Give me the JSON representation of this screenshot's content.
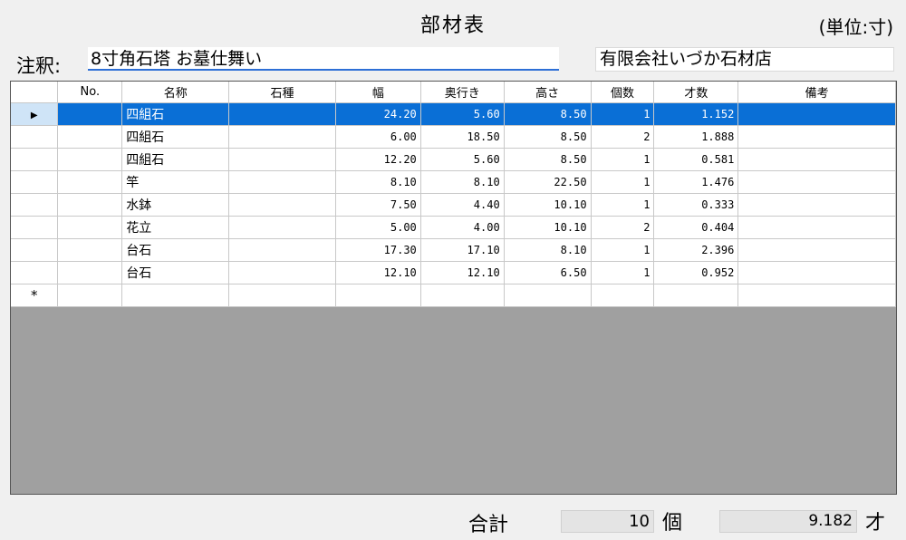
{
  "header": {
    "title": "部材表",
    "unit": "(単位:寸)"
  },
  "note": {
    "label": "注釈:",
    "value": "8寸角石塔  お墓仕舞い"
  },
  "company": {
    "value": "有限会社いづか石材店"
  },
  "grid": {
    "columns": [
      "",
      "No.",
      "名称",
      "石種",
      "幅",
      "奥行き",
      "高さ",
      "個数",
      "才数",
      "備考"
    ],
    "rows": [
      {
        "no": "",
        "name": "四組石",
        "stone": "",
        "width": "24.20",
        "depth": "5.60",
        "height": "8.50",
        "qty": "1",
        "sai": "1.152",
        "remarks": ""
      },
      {
        "no": "",
        "name": "四組石",
        "stone": "",
        "width": "6.00",
        "depth": "18.50",
        "height": "8.50",
        "qty": "2",
        "sai": "1.888",
        "remarks": ""
      },
      {
        "no": "",
        "name": "四組石",
        "stone": "",
        "width": "12.20",
        "depth": "5.60",
        "height": "8.50",
        "qty": "1",
        "sai": "0.581",
        "remarks": ""
      },
      {
        "no": "",
        "name": "竿",
        "stone": "",
        "width": "8.10",
        "depth": "8.10",
        "height": "22.50",
        "qty": "1",
        "sai": "1.476",
        "remarks": ""
      },
      {
        "no": "",
        "name": "水鉢",
        "stone": "",
        "width": "7.50",
        "depth": "4.40",
        "height": "10.10",
        "qty": "1",
        "sai": "0.333",
        "remarks": ""
      },
      {
        "no": "",
        "name": "花立",
        "stone": "",
        "width": "5.00",
        "depth": "4.00",
        "height": "10.10",
        "qty": "2",
        "sai": "0.404",
        "remarks": ""
      },
      {
        "no": "",
        "name": "台石",
        "stone": "",
        "width": "17.30",
        "depth": "17.10",
        "height": "8.10",
        "qty": "1",
        "sai": "2.396",
        "remarks": ""
      },
      {
        "no": "",
        "name": "台石",
        "stone": "",
        "width": "12.10",
        "depth": "12.10",
        "height": "6.50",
        "qty": "1",
        "sai": "0.952",
        "remarks": ""
      }
    ],
    "selected_marker": "▶",
    "new_row_marker": "*"
  },
  "totals": {
    "label": "合計",
    "count": "10",
    "count_unit": "個",
    "sai": "9.182",
    "sai_unit": "才"
  }
}
